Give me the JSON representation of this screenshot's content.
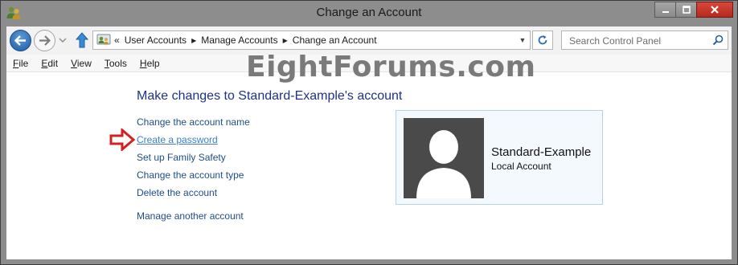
{
  "window": {
    "title": "Change an Account"
  },
  "nav": {
    "breadcrumb_lead": "«",
    "breadcrumbs": [
      "User Accounts",
      "Manage Accounts",
      "Change an Account"
    ],
    "search_placeholder": "Search Control Panel"
  },
  "menu": {
    "file": {
      "accel": "F",
      "rest": "ile"
    },
    "edit": {
      "accel": "E",
      "rest": "dit"
    },
    "view": {
      "accel": "V",
      "rest": "iew"
    },
    "tools": {
      "accel": "T",
      "rest": "ools"
    },
    "help": {
      "accel": "H",
      "rest": "elp"
    }
  },
  "watermark": "EightForums.com",
  "main": {
    "heading": "Make changes to Standard-Example's account",
    "tasks": [
      "Change the account name",
      "Create a password",
      "Set up Family Safety",
      "Change the account type",
      "Delete the account"
    ],
    "manage_other": "Manage another account"
  },
  "account": {
    "name": "Standard-Example",
    "type": "Local Account"
  },
  "colors": {
    "link": "#1e4d87",
    "heading": "#1e3287",
    "highlight_arrow": "#d32020",
    "card_border": "#b9d3e6"
  }
}
